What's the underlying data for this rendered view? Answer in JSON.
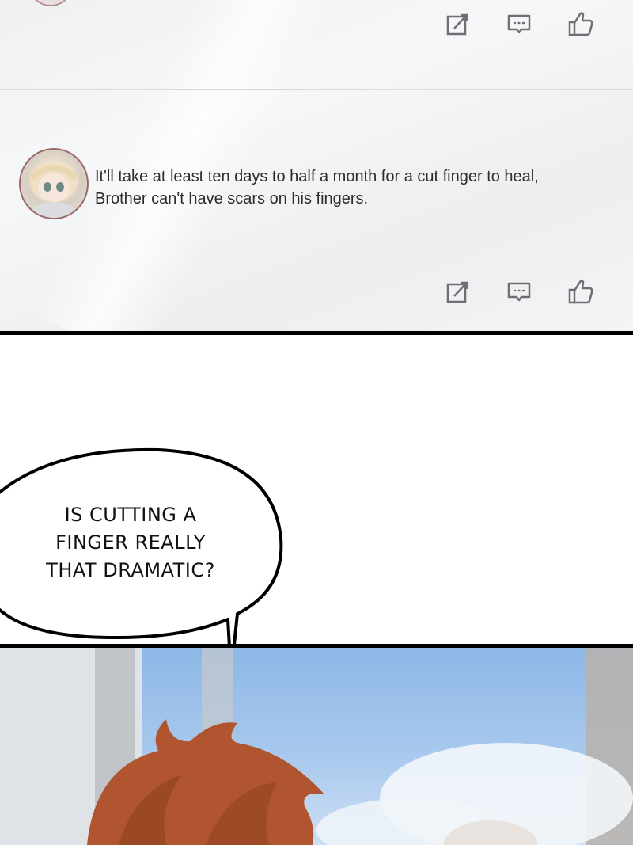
{
  "comments": [
    {
      "text": "It'll take at least ten days to half a month for a cut finger to heal,\nBrother can't have scars on his fingers.",
      "actions": {
        "edit_icon": "edit-icon",
        "comment_icon": "comment-icon",
        "like_icon": "thumbs-up-icon"
      }
    }
  ],
  "speech_bubble": {
    "text": "IS CUTTING A\nFINGER REALLY\nTHAT DRAMATIC?"
  },
  "colors": {
    "ink": "#000000",
    "icon_gray": "#6e6f72",
    "avatar_border": "#9a6a6a",
    "hair": "#b0552f",
    "sky": "#8db7e6"
  }
}
